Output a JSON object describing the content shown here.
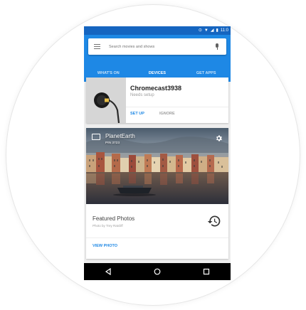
{
  "status_bar": {
    "time": "11:0"
  },
  "search": {
    "placeholder": "Search movies and shows"
  },
  "tabs": [
    {
      "label": "WHAT'S ON"
    },
    {
      "label": "DEVICES"
    },
    {
      "label": "GET APPS"
    }
  ],
  "device_card": {
    "name": "Chromecast3938",
    "status": "Needs setup",
    "setup_label": "SET UP",
    "ignore_label": "IGNORE"
  },
  "photo_card": {
    "device_name": "PlanetEarth",
    "pin": "PIN 3723",
    "title": "Featured Photos",
    "credit": "Photo by Trey Ratcliff",
    "view_label": "VIEW PHOTO"
  },
  "colors": {
    "primary": "#1e88e5",
    "status_bar": "#1565c0",
    "nav_bar": "#000000"
  }
}
